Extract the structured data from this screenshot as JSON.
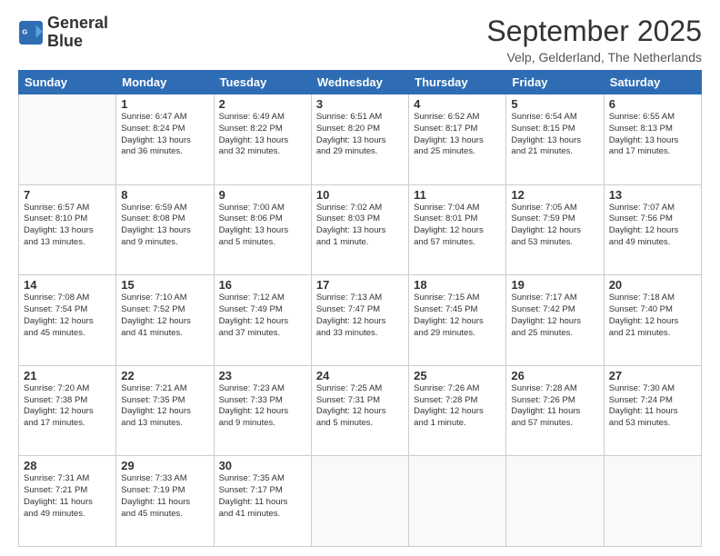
{
  "logo": {
    "line1": "General",
    "line2": "Blue"
  },
  "title": "September 2025",
  "subtitle": "Velp, Gelderland, The Netherlands",
  "days_of_week": [
    "Sunday",
    "Monday",
    "Tuesday",
    "Wednesday",
    "Thursday",
    "Friday",
    "Saturday"
  ],
  "weeks": [
    [
      {
        "day": "",
        "info": ""
      },
      {
        "day": "1",
        "info": "Sunrise: 6:47 AM\nSunset: 8:24 PM\nDaylight: 13 hours\nand 36 minutes."
      },
      {
        "day": "2",
        "info": "Sunrise: 6:49 AM\nSunset: 8:22 PM\nDaylight: 13 hours\nand 32 minutes."
      },
      {
        "day": "3",
        "info": "Sunrise: 6:51 AM\nSunset: 8:20 PM\nDaylight: 13 hours\nand 29 minutes."
      },
      {
        "day": "4",
        "info": "Sunrise: 6:52 AM\nSunset: 8:17 PM\nDaylight: 13 hours\nand 25 minutes."
      },
      {
        "day": "5",
        "info": "Sunrise: 6:54 AM\nSunset: 8:15 PM\nDaylight: 13 hours\nand 21 minutes."
      },
      {
        "day": "6",
        "info": "Sunrise: 6:55 AM\nSunset: 8:13 PM\nDaylight: 13 hours\nand 17 minutes."
      }
    ],
    [
      {
        "day": "7",
        "info": "Sunrise: 6:57 AM\nSunset: 8:10 PM\nDaylight: 13 hours\nand 13 minutes."
      },
      {
        "day": "8",
        "info": "Sunrise: 6:59 AM\nSunset: 8:08 PM\nDaylight: 13 hours\nand 9 minutes."
      },
      {
        "day": "9",
        "info": "Sunrise: 7:00 AM\nSunset: 8:06 PM\nDaylight: 13 hours\nand 5 minutes."
      },
      {
        "day": "10",
        "info": "Sunrise: 7:02 AM\nSunset: 8:03 PM\nDaylight: 13 hours\nand 1 minute."
      },
      {
        "day": "11",
        "info": "Sunrise: 7:04 AM\nSunset: 8:01 PM\nDaylight: 12 hours\nand 57 minutes."
      },
      {
        "day": "12",
        "info": "Sunrise: 7:05 AM\nSunset: 7:59 PM\nDaylight: 12 hours\nand 53 minutes."
      },
      {
        "day": "13",
        "info": "Sunrise: 7:07 AM\nSunset: 7:56 PM\nDaylight: 12 hours\nand 49 minutes."
      }
    ],
    [
      {
        "day": "14",
        "info": "Sunrise: 7:08 AM\nSunset: 7:54 PM\nDaylight: 12 hours\nand 45 minutes."
      },
      {
        "day": "15",
        "info": "Sunrise: 7:10 AM\nSunset: 7:52 PM\nDaylight: 12 hours\nand 41 minutes."
      },
      {
        "day": "16",
        "info": "Sunrise: 7:12 AM\nSunset: 7:49 PM\nDaylight: 12 hours\nand 37 minutes."
      },
      {
        "day": "17",
        "info": "Sunrise: 7:13 AM\nSunset: 7:47 PM\nDaylight: 12 hours\nand 33 minutes."
      },
      {
        "day": "18",
        "info": "Sunrise: 7:15 AM\nSunset: 7:45 PM\nDaylight: 12 hours\nand 29 minutes."
      },
      {
        "day": "19",
        "info": "Sunrise: 7:17 AM\nSunset: 7:42 PM\nDaylight: 12 hours\nand 25 minutes."
      },
      {
        "day": "20",
        "info": "Sunrise: 7:18 AM\nSunset: 7:40 PM\nDaylight: 12 hours\nand 21 minutes."
      }
    ],
    [
      {
        "day": "21",
        "info": "Sunrise: 7:20 AM\nSunset: 7:38 PM\nDaylight: 12 hours\nand 17 minutes."
      },
      {
        "day": "22",
        "info": "Sunrise: 7:21 AM\nSunset: 7:35 PM\nDaylight: 12 hours\nand 13 minutes."
      },
      {
        "day": "23",
        "info": "Sunrise: 7:23 AM\nSunset: 7:33 PM\nDaylight: 12 hours\nand 9 minutes."
      },
      {
        "day": "24",
        "info": "Sunrise: 7:25 AM\nSunset: 7:31 PM\nDaylight: 12 hours\nand 5 minutes."
      },
      {
        "day": "25",
        "info": "Sunrise: 7:26 AM\nSunset: 7:28 PM\nDaylight: 12 hours\nand 1 minute."
      },
      {
        "day": "26",
        "info": "Sunrise: 7:28 AM\nSunset: 7:26 PM\nDaylight: 11 hours\nand 57 minutes."
      },
      {
        "day": "27",
        "info": "Sunrise: 7:30 AM\nSunset: 7:24 PM\nDaylight: 11 hours\nand 53 minutes."
      }
    ],
    [
      {
        "day": "28",
        "info": "Sunrise: 7:31 AM\nSunset: 7:21 PM\nDaylight: 11 hours\nand 49 minutes."
      },
      {
        "day": "29",
        "info": "Sunrise: 7:33 AM\nSunset: 7:19 PM\nDaylight: 11 hours\nand 45 minutes."
      },
      {
        "day": "30",
        "info": "Sunrise: 7:35 AM\nSunset: 7:17 PM\nDaylight: 11 hours\nand 41 minutes."
      },
      {
        "day": "",
        "info": ""
      },
      {
        "day": "",
        "info": ""
      },
      {
        "day": "",
        "info": ""
      },
      {
        "day": "",
        "info": ""
      }
    ]
  ]
}
